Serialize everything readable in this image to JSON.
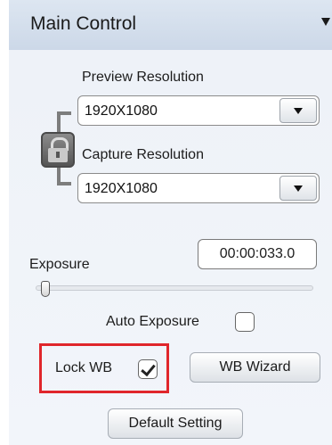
{
  "panel": {
    "title": "Main Control",
    "collapse_icon": "triangle-down-icon"
  },
  "preview": {
    "label": "Preview Resolution",
    "value": "1920X1080"
  },
  "capture": {
    "label": "Capture Resolution",
    "value": "1920X1080"
  },
  "lock_icon": "padlock-icon",
  "exposure": {
    "label": "Exposure",
    "time_value": "00:00:033.0",
    "slider_level": 0.02
  },
  "auto_exposure": {
    "label": "Auto Exposure",
    "checked": false
  },
  "lock_wb": {
    "label": "Lock WB",
    "checked": true
  },
  "buttons": {
    "wb_wizard": "WB Wizard",
    "default_setting": "Default Setting"
  },
  "colors": {
    "highlight": "#e0262b",
    "header_bg": "#d6e0ee",
    "panel_bg": "#f0f4fa"
  }
}
